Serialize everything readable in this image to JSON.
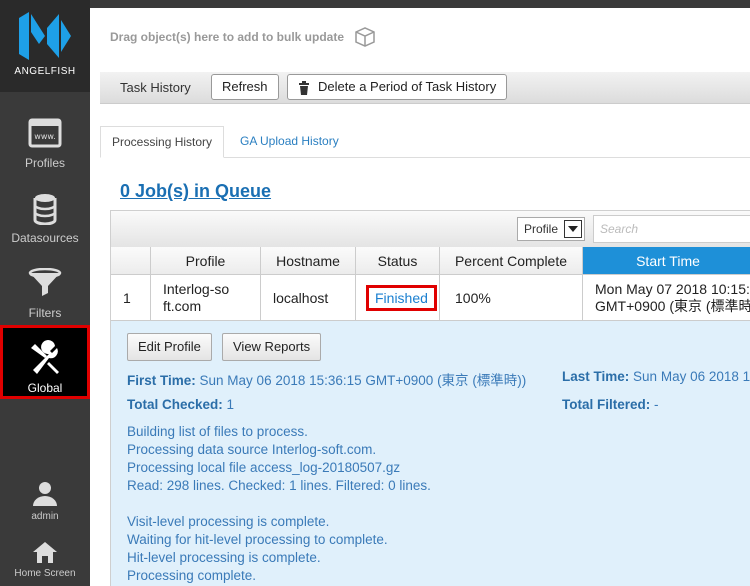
{
  "sidebar": {
    "logo_text": "ANGELFISH",
    "items": [
      {
        "label": "Profiles",
        "icon": "browser-window-icon"
      },
      {
        "label": "Datasources",
        "icon": "database-icon"
      },
      {
        "label": "Filters",
        "icon": "funnel-icon"
      },
      {
        "label": "Global",
        "icon": "wrench-screwdriver-icon"
      }
    ],
    "user_label": "admin",
    "home_label": "Home Screen"
  },
  "dropzone": {
    "text": "Drag object(s) here to add to bulk update"
  },
  "toolbar": {
    "title": "Task History",
    "refresh_label": "Refresh",
    "delete_label": "Delete a Period of Task History"
  },
  "tabs": [
    {
      "label": "Processing History",
      "active": true
    },
    {
      "label": "GA Upload History",
      "active": false
    }
  ],
  "queue_text": "0 Job(s) in Queue",
  "grid": {
    "filter_select": "Profile",
    "search_placeholder": "Search",
    "columns": [
      "",
      "Profile",
      "Hostname",
      "Status",
      "Percent Complete",
      "Start Time"
    ],
    "row": {
      "num": "1",
      "profile": "Interlog-soft.com",
      "hostname": "localhost",
      "status": "Finished",
      "percent": "100%",
      "start_time_1": "Mon May 07 2018 10:15:",
      "start_time_2": "GMT+0900 (東京 (標準時"
    }
  },
  "details": {
    "edit_label": "Edit Profile",
    "reports_label": "View Reports",
    "first_time_label": "First Time:",
    "first_time_value": "Sun May 06 2018 15:36:15 GMT+0900 (東京 (標準時))",
    "last_time_label": "Last Time:",
    "last_time_value": "Sun May 06 2018 1",
    "total_checked_label": "Total Checked:",
    "total_checked_value": "1",
    "total_filtered_label": "Total Filtered:",
    "total_filtered_value": "-",
    "log_lines": [
      "Building list of files to process.",
      "Processing data source Interlog-soft.com.",
      "Processing local file access_log-20180507.gz",
      "Read: 298 lines. Checked: 1 lines. Filtered: 0 lines.",
      "",
      "Visit-level processing is complete.",
      "Waiting for hit-level processing to complete.",
      "Hit-level processing is complete.",
      "Processing complete."
    ]
  },
  "colors": {
    "accent": "#1e90d8",
    "link": "#1a7fd0",
    "highlight": "#e00000",
    "sidebar": "#3a3a3a"
  }
}
